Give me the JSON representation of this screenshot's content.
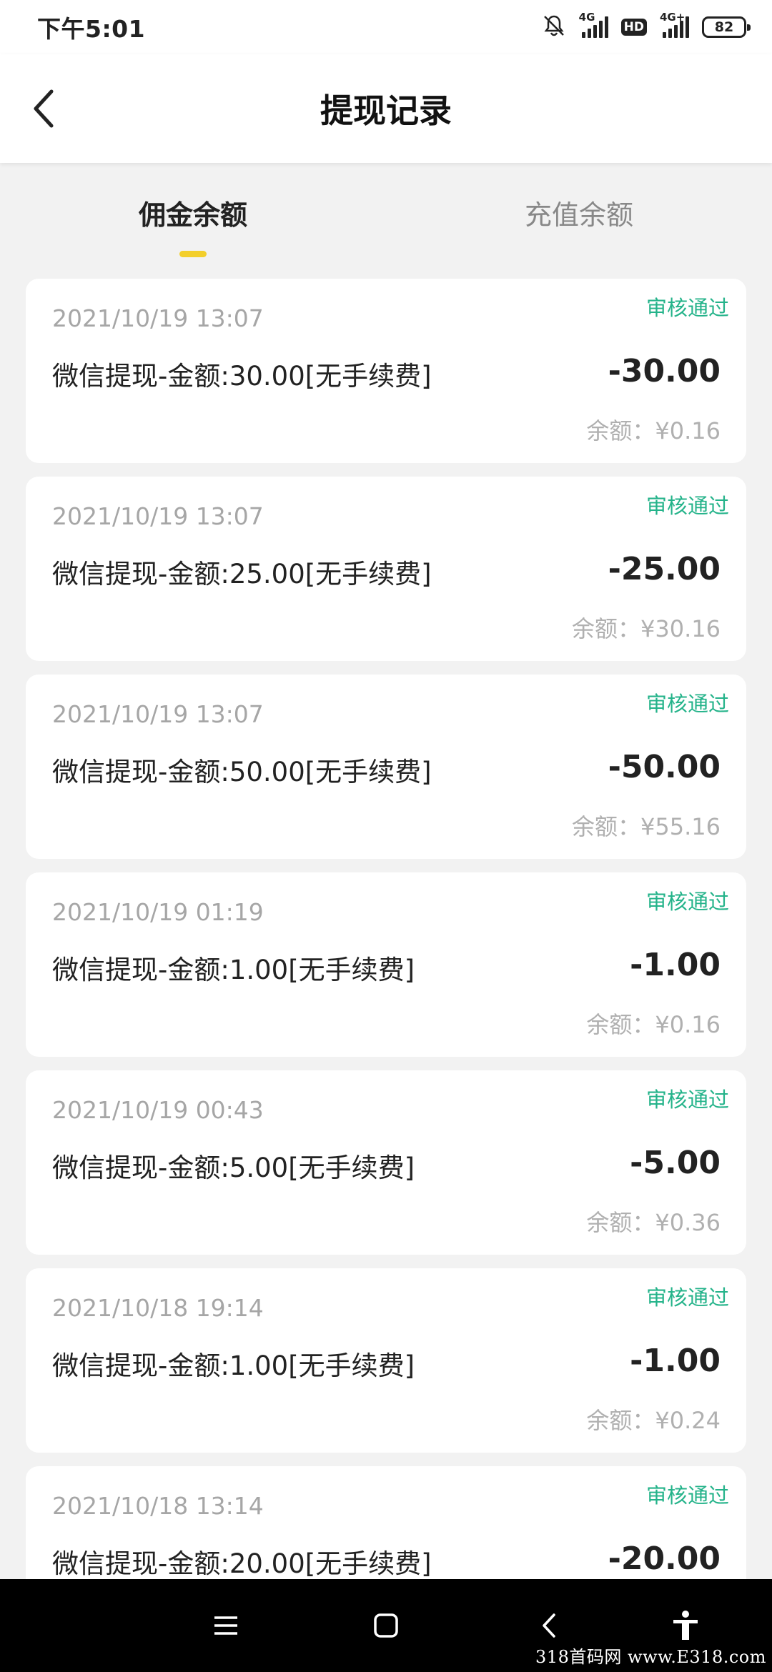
{
  "status_bar": {
    "time": "下午5:01",
    "network_1": "4G",
    "hd": "HD",
    "network_2": "4G+",
    "battery": "82"
  },
  "header": {
    "title": "提现记录"
  },
  "tabs": [
    {
      "label": "佣金余额",
      "active": true
    },
    {
      "label": "充值余额",
      "active": false
    }
  ],
  "records": [
    {
      "time": "2021/10/19 13:07",
      "status": "审核通过",
      "desc": "微信提现-金额:30.00[无手续费]",
      "amount": "-30.00",
      "balance": "余额：¥0.16"
    },
    {
      "time": "2021/10/19 13:07",
      "status": "审核通过",
      "desc": "微信提现-金额:25.00[无手续费]",
      "amount": "-25.00",
      "balance": "余额：¥30.16"
    },
    {
      "time": "2021/10/19 13:07",
      "status": "审核通过",
      "desc": "微信提现-金额:50.00[无手续费]",
      "amount": "-50.00",
      "balance": "余额：¥55.16"
    },
    {
      "time": "2021/10/19 01:19",
      "status": "审核通过",
      "desc": "微信提现-金额:1.00[无手续费]",
      "amount": "-1.00",
      "balance": "余额：¥0.16"
    },
    {
      "time": "2021/10/19 00:43",
      "status": "审核通过",
      "desc": "微信提现-金额:5.00[无手续费]",
      "amount": "-5.00",
      "balance": "余额：¥0.36"
    },
    {
      "time": "2021/10/18 19:14",
      "status": "审核通过",
      "desc": "微信提现-金额:1.00[无手续费]",
      "amount": "-1.00",
      "balance": "余额：¥0.24"
    },
    {
      "time": "2021/10/18 13:14",
      "status": "审核通过",
      "desc": "微信提现-金额:20.00[无手续费]",
      "amount": "-20.00",
      "balance": ""
    }
  ],
  "icons": {
    "back": "chevron-left-icon",
    "menu": "menu-icon",
    "home": "home-square-icon",
    "nav_back": "nav-back-icon",
    "accessibility": "accessibility-icon",
    "mute": "bell-off-icon"
  },
  "colors": {
    "accent_yellow": "#f3cf2b",
    "status_green": "#24b38a",
    "background": "#f2f2f2"
  },
  "watermark": "318首码网 www.E318.com"
}
